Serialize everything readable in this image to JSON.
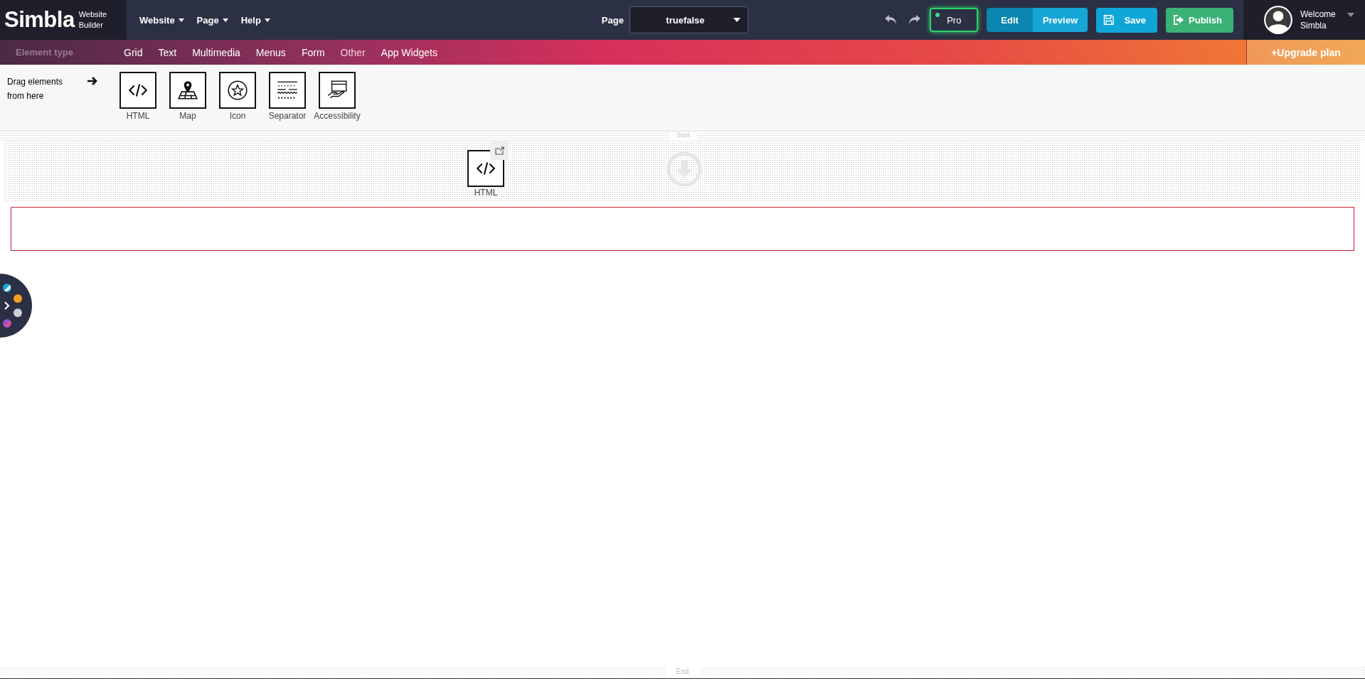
{
  "logo": {
    "name": "Simbla",
    "tagline_1": "Website",
    "tagline_2": "Builder"
  },
  "menu": [
    {
      "label": "Website"
    },
    {
      "label": "Page"
    },
    {
      "label": "Help"
    }
  ],
  "page_picker": {
    "label": "Page",
    "value": "truefalse"
  },
  "pro_badge": {
    "label": "Pro"
  },
  "mode_toggle": [
    {
      "label": "Edit",
      "selected": true
    },
    {
      "label": "Preview",
      "selected": false
    }
  ],
  "save_button": "Save",
  "publish_button": "Publish",
  "user": {
    "greeting": "Welcome",
    "name": "Simbla"
  },
  "element_types": {
    "heading": "Element type",
    "tabs": [
      {
        "label": "Grid",
        "selected": false
      },
      {
        "label": "Text",
        "selected": false
      },
      {
        "label": "Multimedia",
        "selected": false
      },
      {
        "label": "Menus",
        "selected": false
      },
      {
        "label": "Form",
        "selected": false
      },
      {
        "label": "Other",
        "selected": true
      },
      {
        "label": "App Widgets",
        "selected": false
      }
    ]
  },
  "upgrade_button": "+Upgrade plan",
  "palette": {
    "hint": "Drag elements from here",
    "items": [
      {
        "label": "HTML",
        "kind": "html"
      },
      {
        "label": "Map",
        "kind": "map"
      },
      {
        "label": "Icon",
        "kind": "icon"
      },
      {
        "label": "Separator",
        "kind": "separator"
      },
      {
        "label": "Accessibility",
        "kind": "accessibility"
      }
    ]
  },
  "canvas": {
    "start_label": "Start",
    "placed_element": {
      "label": "HTML",
      "kind": "html"
    },
    "end_label": "End"
  }
}
